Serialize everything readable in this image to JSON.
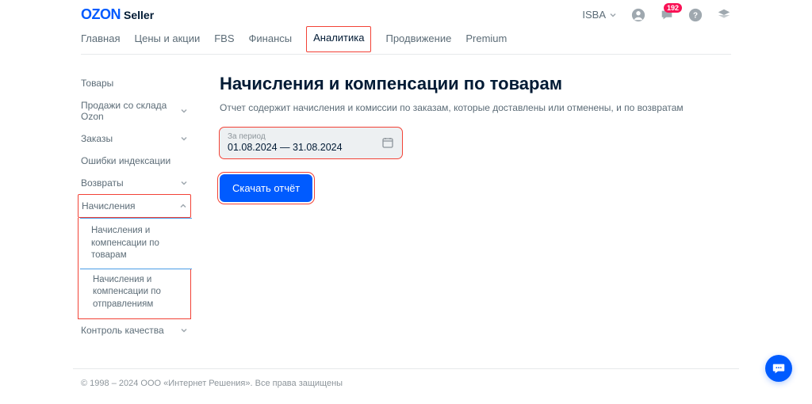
{
  "header": {
    "logo_brand": "OZON",
    "logo_suffix": "Seller",
    "account": "ISBA",
    "notif_count": "192"
  },
  "tabs": [
    {
      "label": "Главная",
      "active": false
    },
    {
      "label": "Цены и акции",
      "active": false
    },
    {
      "label": "FBS",
      "active": false
    },
    {
      "label": "Финансы",
      "active": false
    },
    {
      "label": "Аналитика",
      "active": true,
      "highlight": true
    },
    {
      "label": "Продвижение",
      "active": false
    },
    {
      "label": "Premium",
      "active": false
    }
  ],
  "sidebar": {
    "items": [
      {
        "label": "Товары",
        "expandable": false
      },
      {
        "label": "Продажи со склада Ozon",
        "expandable": true,
        "expanded": false
      },
      {
        "label": "Заказы",
        "expandable": true,
        "expanded": false
      },
      {
        "label": "Ошибки индексации",
        "expandable": false
      },
      {
        "label": "Возвраты",
        "expandable": true,
        "expanded": false
      },
      {
        "label": "Начисления",
        "expandable": true,
        "expanded": true,
        "highlight": true,
        "subs": [
          {
            "label": "Начисления и компенсации по товарам",
            "active": true
          },
          {
            "label": "Начисления и компенсации по отправлениям",
            "active": false
          }
        ]
      },
      {
        "label": "Контроль качества",
        "expandable": true,
        "expanded": false
      }
    ]
  },
  "main": {
    "title": "Начисления и компенсации по товарам",
    "description": "Отчет содержит начисления и комиссии по заказам, которые доставлены или отменены, и по возвратам",
    "period_label": "За период",
    "period_value": "01.08.2024 — 31.08.2024",
    "download_btn": "Скачать отчёт"
  },
  "footer": {
    "text": "© 1998 – 2024 ООО «Интернет Решения». Все права защищены"
  }
}
